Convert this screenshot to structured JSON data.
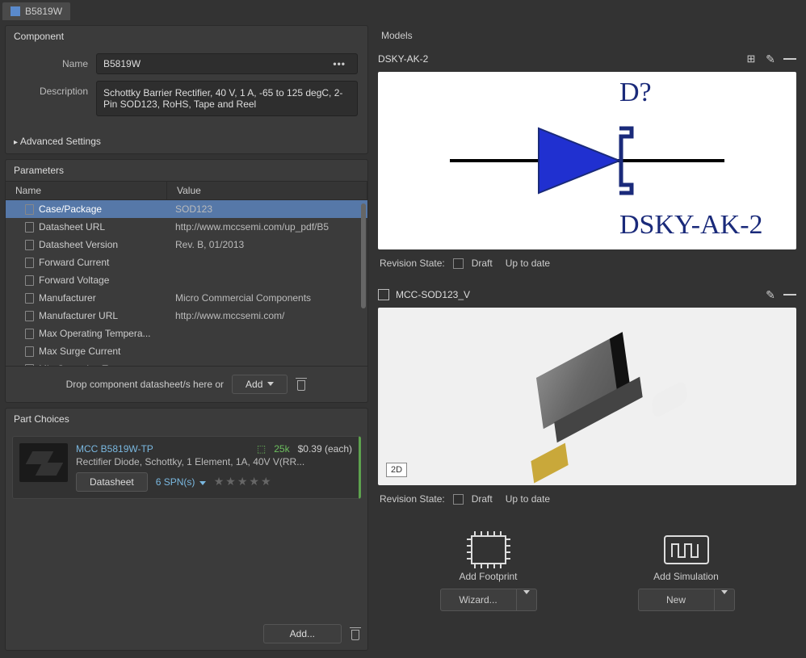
{
  "tab": {
    "title": "B5819W"
  },
  "component": {
    "header": "Component",
    "name_label": "Name",
    "name_value": "B5819W",
    "desc_label": "Description",
    "desc_value": "Schottky Barrier Rectifier, 40 V, 1 A, -65 to 125 degC, 2-Pin SOD123, RoHS, Tape and Reel",
    "advanced": "Advanced Settings"
  },
  "parameters": {
    "header": "Parameters",
    "col_name": "Name",
    "col_value": "Value",
    "rows": [
      {
        "name": "Case/Package",
        "value": "SOD123",
        "selected": true
      },
      {
        "name": "Datasheet URL",
        "value": "http://www.mccsemi.com/up_pdf/B5"
      },
      {
        "name": "Datasheet Version",
        "value": "Rev. B, 01/2013"
      },
      {
        "name": "Forward Current",
        "value": ""
      },
      {
        "name": "Forward Voltage",
        "value": ""
      },
      {
        "name": "Manufacturer",
        "value": "Micro Commercial Components"
      },
      {
        "name": "Manufacturer URL",
        "value": "http://www.mccsemi.com/"
      },
      {
        "name": "Max Operating Tempera...",
        "value": ""
      },
      {
        "name": "Max Surge Current",
        "value": ""
      },
      {
        "name": "Min Operating Tempera...",
        "value": ""
      }
    ],
    "drop_text": "Drop component datasheet/s here or",
    "add_btn": "Add"
  },
  "part_choices": {
    "header": "Part Choices",
    "card": {
      "title": "MCC B5819W-TP",
      "stock": "25k",
      "price": "$0.39 (each)",
      "desc": "Rectifier Diode, Schottky, 1 Element, 1A, 40V V(RR...",
      "datasheet_btn": "Datasheet",
      "spn": "6 SPN(s)"
    },
    "add_btn": "Add..."
  },
  "models": {
    "header": "Models",
    "symbol": {
      "title": "DSKY-AK-2",
      "designator": "D?",
      "label": "DSKY-AK-2",
      "rev_label": "Revision State:",
      "draft": "Draft",
      "uptodate": "Up to date"
    },
    "footprint": {
      "title": "MCC-SOD123_V",
      "badge": "2D",
      "rev_label": "Revision State:",
      "draft": "Draft",
      "uptodate": "Up to date"
    },
    "add_footprint": {
      "label": "Add Footprint",
      "btn": "Wizard..."
    },
    "add_simulation": {
      "label": "Add Simulation",
      "btn": "New"
    }
  }
}
